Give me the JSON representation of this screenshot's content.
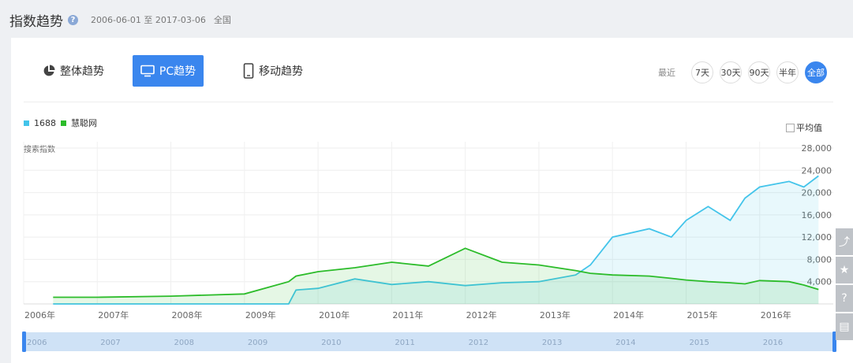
{
  "header": {
    "title": "指数趋势",
    "help_icon": "question-circle-icon",
    "date_range": "2006-06-01 至 2017-03-06",
    "region": "全国"
  },
  "tabs": [
    {
      "label": "整体趋势",
      "icon": "pie-chart-icon",
      "active": false
    },
    {
      "label": "PC趋势",
      "icon": "monitor-icon",
      "active": true
    },
    {
      "label": "移动趋势",
      "icon": "mobile-icon",
      "active": false
    }
  ],
  "recent": {
    "label": "最近",
    "options": [
      "7天",
      "30天",
      "90天",
      "半年",
      "全部"
    ],
    "selected": "全部"
  },
  "legend": {
    "items": [
      {
        "name": "1688",
        "color": "#43c4ea"
      },
      {
        "name": "慧聪网",
        "color": "#2cbc2a"
      }
    ]
  },
  "average_toggle": {
    "label": "平均值",
    "checked": false
  },
  "chart_data": {
    "type": "area",
    "ylabel": "搜索指数",
    "ylim": [
      0,
      28000
    ],
    "y_ticks": [
      "28,000",
      "24,000",
      "20,000",
      "16,000",
      "12,000",
      "8,000",
      "4,000"
    ],
    "x_ticks": [
      "2006年",
      "2007年",
      "2008年",
      "2009年",
      "2010年",
      "2011年",
      "2012年",
      "2013年",
      "2014年",
      "2015年",
      "2016年"
    ],
    "x": [
      2006.4,
      2007.0,
      2008.0,
      2009.0,
      2009.6,
      2009.7,
      2010.0,
      2010.5,
      2011.0,
      2011.5,
      2012.0,
      2012.5,
      2013.0,
      2013.5,
      2013.7,
      2014.0,
      2014.5,
      2014.8,
      2015.0,
      2015.3,
      2015.6,
      2015.8,
      2016.0,
      2016.4,
      2016.6,
      2016.8
    ],
    "series": [
      {
        "name": "1688",
        "color": "#43c4ea",
        "values": [
          0,
          0,
          0,
          0,
          0,
          2500,
          2800,
          4500,
          3500,
          4000,
          3300,
          3800,
          4000,
          5200,
          7000,
          12000,
          13500,
          12000,
          15000,
          17500,
          15000,
          19000,
          21000,
          22000,
          21000,
          23000
        ]
      },
      {
        "name": "慧聪网",
        "color": "#2cbc2a",
        "values": [
          1200,
          1200,
          1400,
          1800,
          4000,
          5000,
          5800,
          6500,
          7500,
          6800,
          10000,
          7500,
          7000,
          6000,
          5500,
          5200,
          5000,
          4600,
          4300,
          4000,
          3800,
          3600,
          4200,
          4000,
          3400,
          2600
        ]
      }
    ]
  },
  "navigator": {
    "labels": [
      "2006",
      "2007",
      "2008",
      "2009",
      "2010",
      "2011",
      "2012",
      "2013",
      "2014",
      "2015",
      "2016"
    ]
  },
  "side_tools": [
    "share-icon",
    "star-icon",
    "help-icon",
    "comment-icon"
  ]
}
